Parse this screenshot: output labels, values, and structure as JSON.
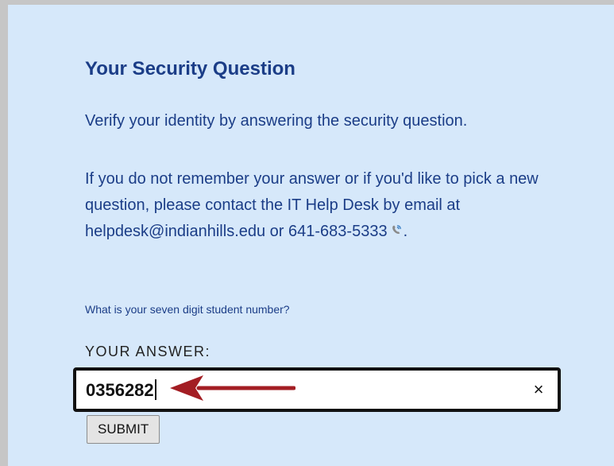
{
  "form": {
    "title": "Your Security Question",
    "intro": "Verify your identity by answering the security question.",
    "help_text_before_phone": "If you do not remember your answer or if you'd like to pick a new question, please contact the IT Help Desk by email at helpdesk@indianhills.edu or 641-683-5333",
    "help_text_after_phone": ".",
    "phone_icon": "phone-call-icon",
    "question": "What is your seven digit student number?",
    "answer_label": "YOUR ANSWER:",
    "answer_value": "0356282",
    "clear_symbol": "×",
    "submit_label": "SUBMIT"
  },
  "colors": {
    "background": "#d6e8fa",
    "text": "#1b3d87",
    "arrow": "#a31d23"
  }
}
